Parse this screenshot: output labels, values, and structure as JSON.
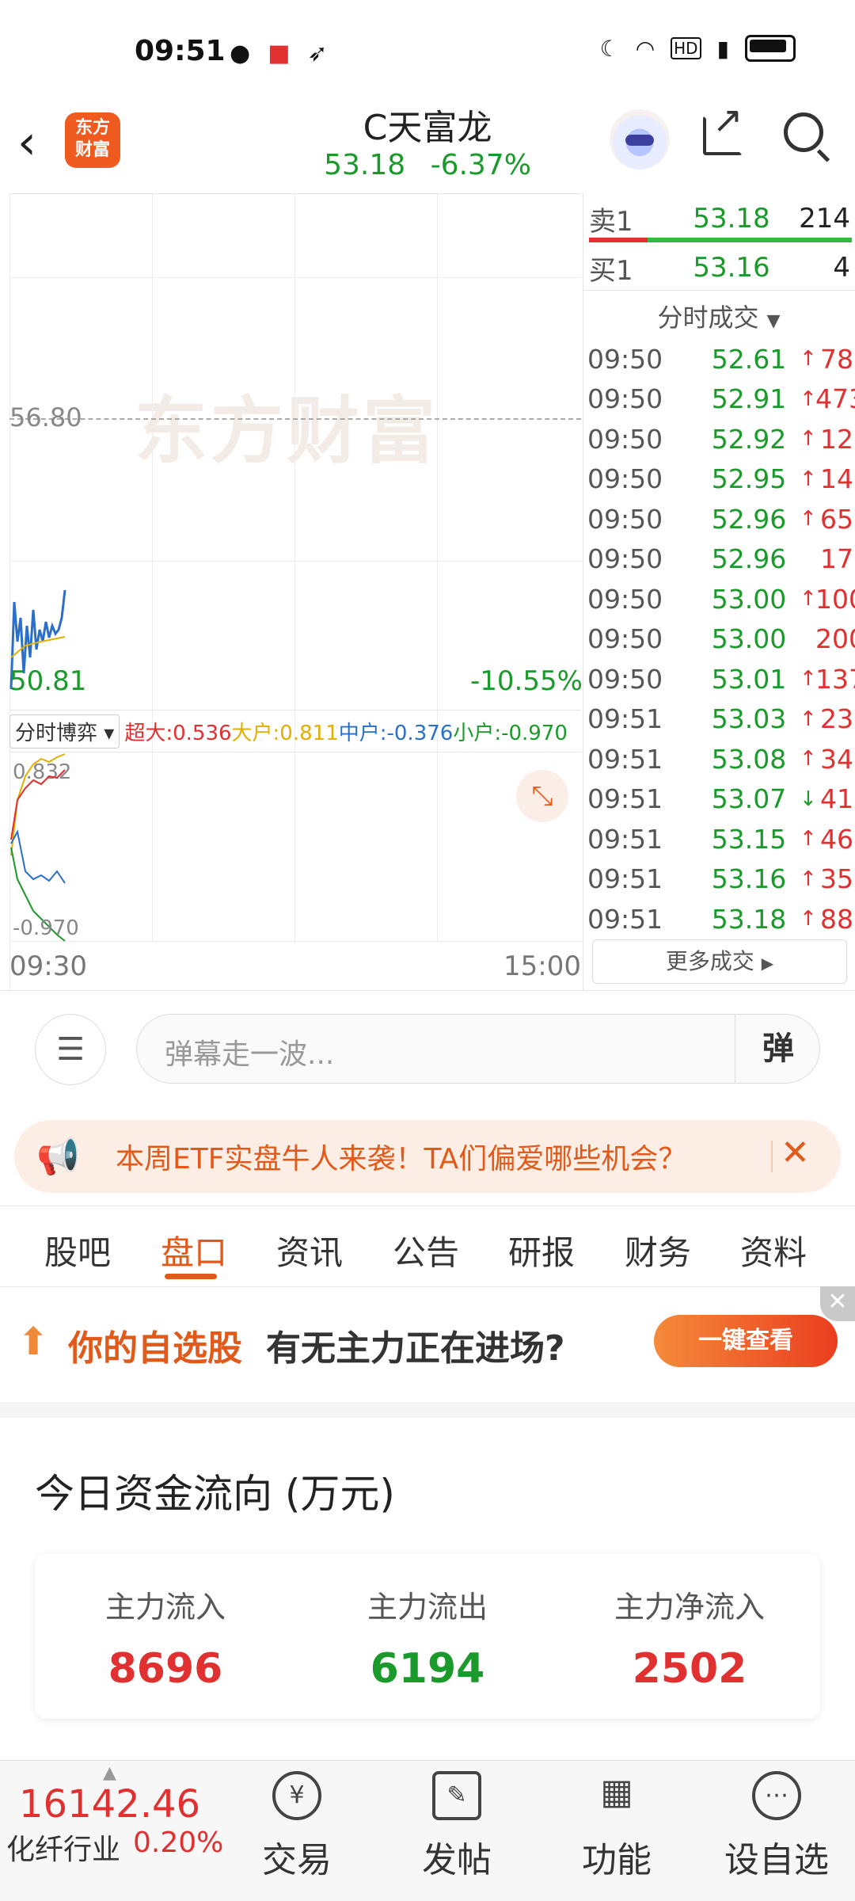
{
  "status": {
    "time": "09:51"
  },
  "header": {
    "logo": "东方\n财富",
    "title": "C天富龙",
    "price": "53.18",
    "change_pct": "-6.37%"
  },
  "chart": {
    "watermark": "东方财富",
    "ref_price": "56.80",
    "low_price": "50.81",
    "low_pct": "-10.55%",
    "indicator_select": "分时博弈",
    "indicators": [
      {
        "label": "超大:0.536",
        "color": "#e03030"
      },
      {
        "label": "大户:0.811",
        "color": "#e2b000"
      },
      {
        "label": "中户:-0.376",
        "color": "#2a6fc9"
      },
      {
        "label": "小户:-0.970",
        "color": "#1a9a2a"
      }
    ],
    "sub_max": "0.832",
    "sub_min": "-0.970",
    "time_start": "09:30",
    "time_end": "15:00"
  },
  "orderbook": {
    "sell1": {
      "label": "卖1",
      "price": "53.18",
      "vol": "214"
    },
    "buy1": {
      "label": "买1",
      "price": "53.16",
      "vol": "4"
    },
    "trades_title": "分时成交",
    "trades": [
      {
        "time": "09:50",
        "price": "52.61",
        "dir": "↑",
        "vol": "78"
      },
      {
        "time": "09:50",
        "price": "52.91",
        "dir": "↑",
        "vol": "473"
      },
      {
        "time": "09:50",
        "price": "52.92",
        "dir": "↑",
        "vol": "12"
      },
      {
        "time": "09:50",
        "price": "52.95",
        "dir": "↑",
        "vol": "14"
      },
      {
        "time": "09:50",
        "price": "52.96",
        "dir": "↑",
        "vol": "65"
      },
      {
        "time": "09:50",
        "price": "52.96",
        "dir": "",
        "vol": "17"
      },
      {
        "time": "09:50",
        "price": "53.00",
        "dir": "↑",
        "vol": "100"
      },
      {
        "time": "09:50",
        "price": "53.00",
        "dir": "",
        "vol": "200"
      },
      {
        "time": "09:50",
        "price": "53.01",
        "dir": "↑",
        "vol": "137"
      },
      {
        "time": "09:51",
        "price": "53.03",
        "dir": "↑",
        "vol": "23"
      },
      {
        "time": "09:51",
        "price": "53.08",
        "dir": "↑",
        "vol": "34"
      },
      {
        "time": "09:51",
        "price": "53.07",
        "dir": "↓",
        "vol": "41"
      },
      {
        "time": "09:51",
        "price": "53.15",
        "dir": "↑",
        "vol": "46"
      },
      {
        "time": "09:51",
        "price": "53.16",
        "dir": "↑",
        "vol": "35"
      },
      {
        "time": "09:51",
        "price": "53.18",
        "dir": "↑",
        "vol": "88"
      }
    ],
    "more": "更多成交"
  },
  "danmu": {
    "placeholder": "弹幕走一波...",
    "button": "弹"
  },
  "banner": {
    "text": "本周ETF实盘牛人来袭！TA们偏爱哪些机会？"
  },
  "tabs": [
    "股吧",
    "盘口",
    "资讯",
    "公告",
    "研报",
    "财务",
    "资料"
  ],
  "active_tab": "盘口",
  "promo": {
    "text1": "你的自选股",
    "text2": "有无主力正在进场?",
    "button": "一键查看"
  },
  "fund_flow": {
    "title": "今日资金流向 (万元)",
    "items": [
      {
        "label": "主力流入",
        "value": "8696",
        "color": "#e03030"
      },
      {
        "label": "主力流出",
        "value": "6194",
        "color": "#1a9a2a"
      },
      {
        "label": "主力净流入",
        "value": "2502",
        "color": "#e03030"
      }
    ]
  },
  "bottom_nav": {
    "index_value": "16142.46",
    "index_name": "化纤行业",
    "index_pct": "0.20%",
    "items": [
      {
        "label": "交易",
        "icon": "yen-icon"
      },
      {
        "label": "发帖",
        "icon": "edit-icon"
      },
      {
        "label": "功能",
        "icon": "grid-icon"
      },
      {
        "label": "设自选",
        "icon": "more-icon"
      }
    ]
  }
}
